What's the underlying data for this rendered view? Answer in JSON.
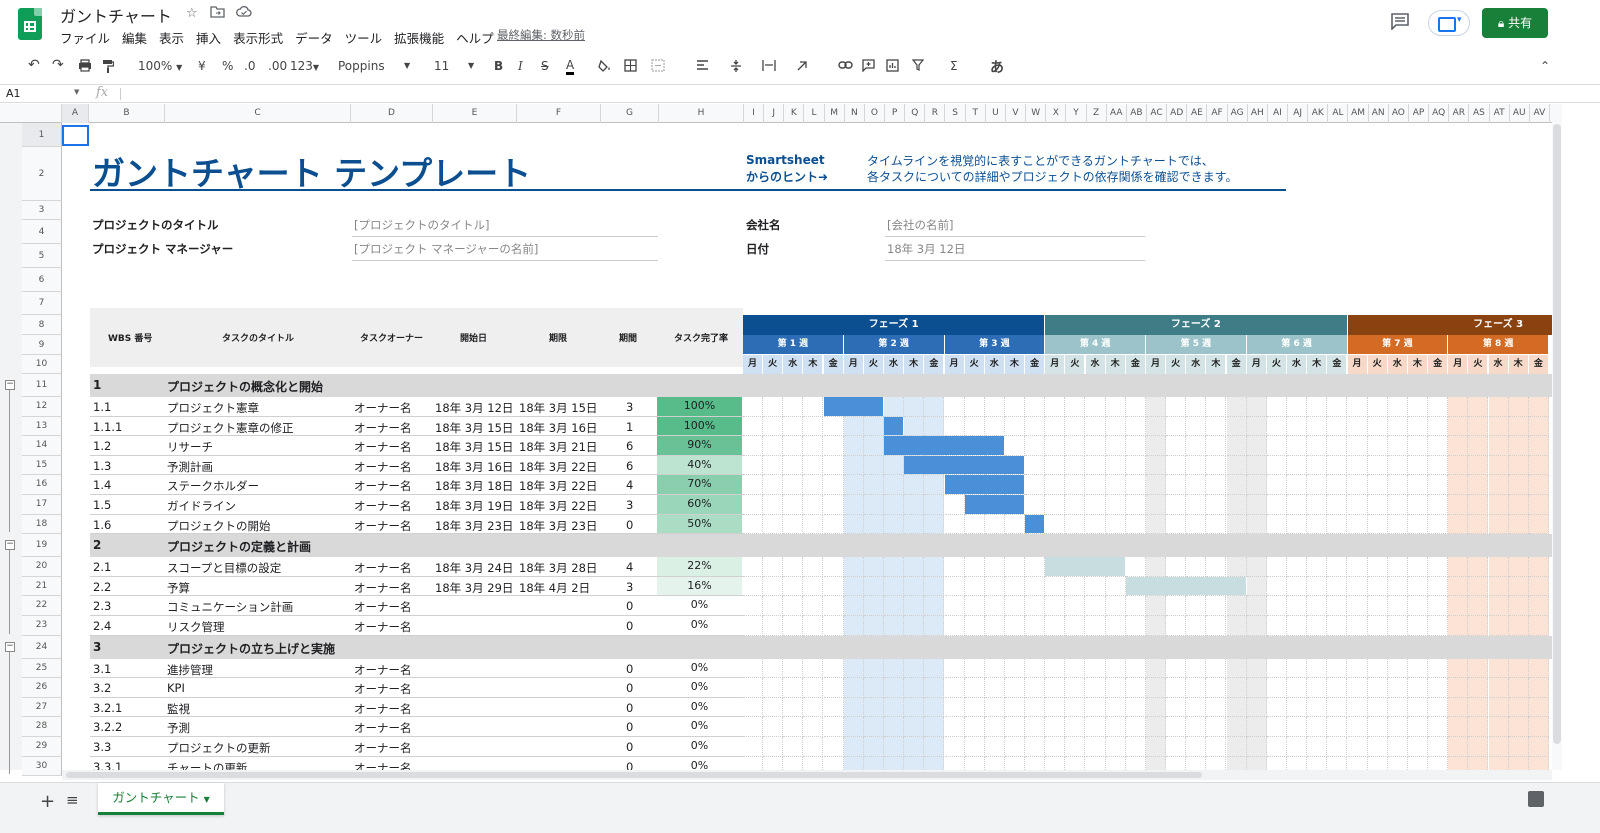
{
  "header": {
    "doc_title": "ガントチャート",
    "menu": [
      "ファイル",
      "編集",
      "表示",
      "挿入",
      "表示形式",
      "データ",
      "ツール",
      "拡張機能",
      "ヘルプ"
    ],
    "last_edit": "最終編集: 数秒前",
    "share_label": "共有",
    "star_icon": "star-icon",
    "folder_icon": "folder-move-icon",
    "cloud_icon": "cloud-status-icon"
  },
  "toolbar": {
    "zoom": "100%",
    "currency": "¥",
    "percent": "%",
    "dec_less": ".0",
    "dec_more": ".00",
    "format_123": "123",
    "font": "Poppins",
    "font_size": "11",
    "bold": "B",
    "italic": "I",
    "strike": "S",
    "text_color": "A",
    "input_tool": "あ"
  },
  "formula_bar": {
    "name_box": "A1",
    "fx": "fx"
  },
  "columns": [
    "A",
    "B",
    "C",
    "D",
    "E",
    "F",
    "G",
    "H",
    "I",
    "J",
    "K",
    "L",
    "M",
    "N",
    "O",
    "P",
    "Q",
    "R",
    "S",
    "T",
    "U",
    "V",
    "W",
    "X",
    "Y",
    "Z",
    "AA",
    "AB",
    "AC",
    "AD",
    "AE",
    "AF",
    "AG",
    "AH",
    "AI",
    "AJ",
    "AK",
    "AL",
    "AM",
    "AN",
    "AO",
    "AP",
    "AQ",
    "AR",
    "AS",
    "AT",
    "AU",
    "AV"
  ],
  "rows": [
    "1",
    "2",
    "3",
    "4",
    "5",
    "6",
    "7",
    "8",
    "9",
    "10",
    "11",
    "12",
    "13",
    "14",
    "15",
    "16",
    "17",
    "18",
    "19",
    "20",
    "21",
    "22",
    "23",
    "24",
    "25",
    "26",
    "27",
    "28",
    "29",
    "30"
  ],
  "title": "ガントチャート テンプレート",
  "hint": {
    "brand_line1": "Smartsheet",
    "brand_line2": "からのヒント➜",
    "text_line1": "タイムラインを視覚的に表すことができるガントチャートでは、",
    "text_line2": "各タスクについての詳細やプロジェクトの依存関係を確認できます。"
  },
  "info": {
    "project_title_label": "プロジェクトのタイトル",
    "project_title_value": "[プロジェクトのタイトル]",
    "manager_label": "プロジェクト マネージャー",
    "manager_value": "[プロジェクト マネージャーの名前]",
    "company_label": "会社名",
    "company_value": "[会社の名前]",
    "date_label": "日付",
    "date_value": "18年 3月 12日"
  },
  "table_headers": {
    "wbs": "WBS 番号",
    "task": "タスクのタイトル",
    "owner": "タスクオーナー",
    "start": "開始日",
    "due": "期限",
    "duration": "期間",
    "complete": "タスク完了率"
  },
  "phases": [
    {
      "label": "フェーズ 1",
      "color": "#0b4f91"
    },
    {
      "label": "フェーズ 2",
      "color": "#3e7c86"
    },
    {
      "label": "フェーズ 3",
      "color": "#8a4211"
    }
  ],
  "weeks": [
    {
      "label": "第 1 週",
      "phase": 0
    },
    {
      "label": "第 2 週",
      "phase": 0
    },
    {
      "label": "第 3 週",
      "phase": 0
    },
    {
      "label": "第 4 週",
      "phase": 1
    },
    {
      "label": "第 5 週",
      "phase": 1
    },
    {
      "label": "第 6 週",
      "phase": 1
    },
    {
      "label": "第 7 週",
      "phase": 2
    },
    {
      "label": "第 8 週",
      "phase": 2
    }
  ],
  "day_labels": [
    "月",
    "火",
    "水",
    "木",
    "金"
  ],
  "tasks": [
    {
      "row": 11,
      "section": true,
      "wbs": "1",
      "title": "プロジェクトの概念化と開始"
    },
    {
      "row": 12,
      "wbs": "1.1",
      "title": "プロジェクト憲章",
      "owner": "オーナー名",
      "start": "18年 3月 12日",
      "due": "18年 3月 15日",
      "duration": "3",
      "pct": "100%",
      "pctv": 1.0,
      "bar": [
        4,
        6
      ],
      "barColor": "#4a90d9"
    },
    {
      "row": 13,
      "wbs": "1.1.1",
      "title": "プロジェクト憲章の修正",
      "owner": "オーナー名",
      "start": "18年 3月 15日",
      "due": "18年 3月 16日",
      "duration": "1",
      "pct": "100%",
      "pctv": 1.0,
      "bar": [
        7,
        7
      ],
      "barColor": "#4a90d9"
    },
    {
      "row": 14,
      "wbs": "1.2",
      "title": "リサーチ",
      "owner": "オーナー名",
      "start": "18年 3月 15日",
      "due": "18年 3月 21日",
      "duration": "6",
      "pct": "90%",
      "pctv": 0.9,
      "bar": [
        7,
        12
      ],
      "barColor": "#4a90d9"
    },
    {
      "row": 15,
      "wbs": "1.3",
      "title": "予測計画",
      "owner": "オーナー名",
      "start": "18年 3月 16日",
      "due": "18年 3月 22日",
      "duration": "6",
      "pct": "40%",
      "pctv": 0.4,
      "bar": [
        8,
        13
      ],
      "barColor": "#4a90d9"
    },
    {
      "row": 16,
      "wbs": "1.4",
      "title": "ステークホルダー",
      "owner": "オーナー名",
      "start": "18年 3月 18日",
      "due": "18年 3月 22日",
      "duration": "4",
      "pct": "70%",
      "pctv": 0.7,
      "bar": [
        10,
        13
      ],
      "barColor": "#4a90d9"
    },
    {
      "row": 17,
      "wbs": "1.5",
      "title": "ガイドライン",
      "owner": "オーナー名",
      "start": "18年 3月 19日",
      "due": "18年 3月 22日",
      "duration": "3",
      "pct": "60%",
      "pctv": 0.6,
      "bar": [
        11,
        13
      ],
      "barColor": "#4a90d9"
    },
    {
      "row": 18,
      "wbs": "1.6",
      "title": "プロジェクトの開始",
      "owner": "オーナー名",
      "start": "18年 3月 23日",
      "due": "18年 3月 23日",
      "duration": "0",
      "pct": "50%",
      "pctv": 0.5,
      "bar": [
        14,
        14
      ],
      "barColor": "#4a90d9"
    },
    {
      "row": 19,
      "section": true,
      "wbs": "2",
      "title": "プロジェクトの定義と計画"
    },
    {
      "row": 20,
      "wbs": "2.1",
      "title": "スコープと目標の設定",
      "owner": "オーナー名",
      "start": "18年 3月 24日",
      "due": "18年 3月 28日",
      "duration": "4",
      "pct": "22%",
      "pctv": 0.22,
      "bar": [
        15,
        18
      ],
      "barColor": "#c8dde0"
    },
    {
      "row": 21,
      "wbs": "2.2",
      "title": "予算",
      "owner": "オーナー名",
      "start": "18年 3月 29日",
      "due": "18年 4月 2日",
      "duration": "3",
      "pct": "16%",
      "pctv": 0.16,
      "bar": [
        19,
        24
      ],
      "barColor": "#c8dde0"
    },
    {
      "row": 22,
      "wbs": "2.3",
      "title": "コミュニケーション計画",
      "owner": "オーナー名",
      "start": "",
      "due": "",
      "duration": "0",
      "pct": "0%",
      "pctv": 0
    },
    {
      "row": 23,
      "wbs": "2.4",
      "title": "リスク管理",
      "owner": "オーナー名",
      "start": "",
      "due": "",
      "duration": "0",
      "pct": "0%",
      "pctv": 0
    },
    {
      "row": 24,
      "section": true,
      "wbs": "3",
      "title": "プロジェクトの立ち上げと実施"
    },
    {
      "row": 25,
      "wbs": "3.1",
      "title": "進捗管理",
      "owner": "オーナー名",
      "start": "",
      "due": "",
      "duration": "0",
      "pct": "0%",
      "pctv": 0
    },
    {
      "row": 26,
      "wbs": "3.2",
      "title": "KPI",
      "owner": "オーナー名",
      "start": "",
      "due": "",
      "duration": "0",
      "pct": "0%",
      "pctv": 0
    },
    {
      "row": 27,
      "wbs": "3.2.1",
      "title": "監視",
      "owner": "オーナー名",
      "start": "",
      "due": "",
      "duration": "0",
      "pct": "0%",
      "pctv": 0
    },
    {
      "row": 28,
      "wbs": "3.2.2",
      "title": "予測",
      "owner": "オーナー名",
      "start": "",
      "due": "",
      "duration": "0",
      "pct": "0%",
      "pctv": 0
    },
    {
      "row": 29,
      "wbs": "3.3",
      "title": "プロジェクトの更新",
      "owner": "オーナー名",
      "start": "",
      "due": "",
      "duration": "0",
      "pct": "0%",
      "pctv": 0
    },
    {
      "row": 30,
      "wbs": "3.3.1",
      "title": "チャートの更新",
      "owner": "オーナー名",
      "start": "",
      "due": "",
      "duration": "0",
      "pct": "0%",
      "pctv": 0
    }
  ],
  "colors": {
    "phase1_day": "#cfe0f3",
    "phase2_day": "#d4e4e6",
    "phase3_day": "#f6d9c8",
    "week_phase1": "#2d6db5",
    "week_phase2": "#9cc3c9",
    "week_phase3": "#d36b25",
    "section_bg": "#d9d9d9",
    "header_bg": "#efefef",
    "title_blue": "#0b4f91",
    "share_green": "#188038"
  },
  "sheet_tab": "ガントチャート"
}
